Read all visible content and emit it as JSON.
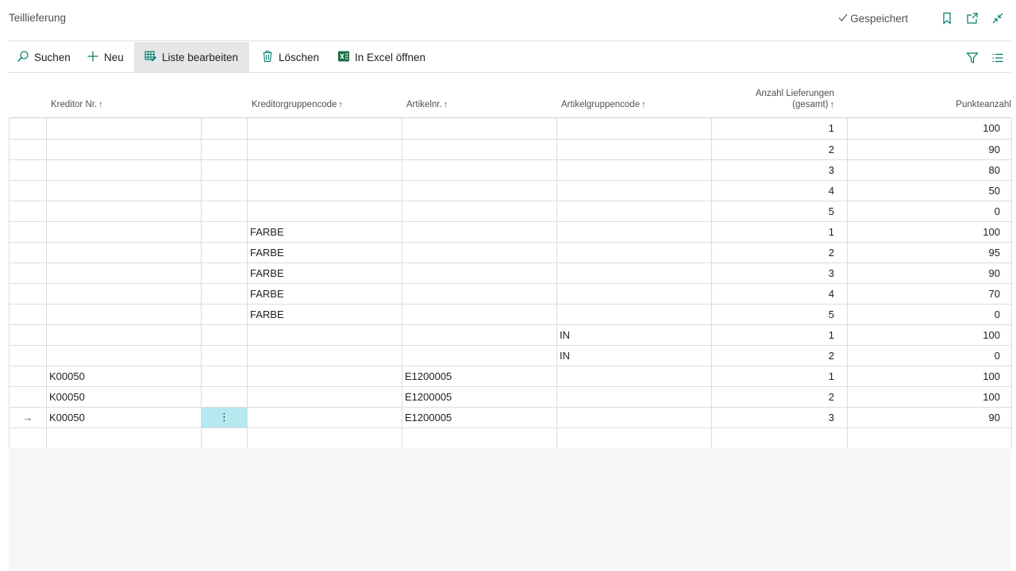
{
  "page": {
    "title": "Teillieferung",
    "saved_label": "Gespeichert"
  },
  "actions": {
    "search": "Suchen",
    "new": "Neu",
    "edit_list": "Liste bearbeiten",
    "delete": "Löschen",
    "excel": "In Excel öffnen"
  },
  "columns": {
    "vendor_no": "Kreditor Nr.",
    "vendor_group": "Kreditorgruppencode",
    "item_no": "Artikelnr.",
    "item_group": "Artikelgruppencode",
    "deliveries_line1": "Anzahl Lieferungen",
    "deliveries_line2": "(gesamt)",
    "points": "Punkteanzahl",
    "sort_arrow": "↑"
  },
  "row_marker": "→",
  "context_menu_glyph": "⋮",
  "rows": [
    {
      "vendor": "",
      "vgroup": "",
      "item": "",
      "igroup": "",
      "deliveries": "1",
      "points": "100"
    },
    {
      "vendor": "",
      "vgroup": "",
      "item": "",
      "igroup": "",
      "deliveries": "2",
      "points": "90"
    },
    {
      "vendor": "",
      "vgroup": "",
      "item": "",
      "igroup": "",
      "deliveries": "3",
      "points": "80"
    },
    {
      "vendor": "",
      "vgroup": "",
      "item": "",
      "igroup": "",
      "deliveries": "4",
      "points": "50"
    },
    {
      "vendor": "",
      "vgroup": "",
      "item": "",
      "igroup": "",
      "deliveries": "5",
      "points": "0"
    },
    {
      "vendor": "",
      "vgroup": "FARBE",
      "item": "",
      "igroup": "",
      "deliveries": "1",
      "points": "100"
    },
    {
      "vendor": "",
      "vgroup": "FARBE",
      "item": "",
      "igroup": "",
      "deliveries": "2",
      "points": "95"
    },
    {
      "vendor": "",
      "vgroup": "FARBE",
      "item": "",
      "igroup": "",
      "deliveries": "3",
      "points": "90"
    },
    {
      "vendor": "",
      "vgroup": "FARBE",
      "item": "",
      "igroup": "",
      "deliveries": "4",
      "points": "70"
    },
    {
      "vendor": "",
      "vgroup": "FARBE",
      "item": "",
      "igroup": "",
      "deliveries": "5",
      "points": "0"
    },
    {
      "vendor": "",
      "vgroup": "",
      "item": "",
      "igroup": "IN",
      "deliveries": "1",
      "points": "100"
    },
    {
      "vendor": "",
      "vgroup": "",
      "item": "",
      "igroup": "IN",
      "deliveries": "2",
      "points": "0"
    },
    {
      "vendor": "K00050",
      "vgroup": "",
      "item": "E1200005",
      "igroup": "",
      "deliveries": "1",
      "points": "100"
    },
    {
      "vendor": "K00050",
      "vgroup": "",
      "item": "E1200005",
      "igroup": "",
      "deliveries": "2",
      "points": "100"
    },
    {
      "vendor": "K00050",
      "vgroup": "",
      "item": "E1200005",
      "igroup": "",
      "deliveries": "3",
      "points": "90"
    },
    {
      "vendor": "",
      "vgroup": "",
      "item": "",
      "igroup": "",
      "deliveries": "",
      "points": ""
    }
  ],
  "colors": {
    "accent": "#00796b",
    "selected_cell": "#b3e9ef",
    "excel_green": "#1d6f42"
  }
}
